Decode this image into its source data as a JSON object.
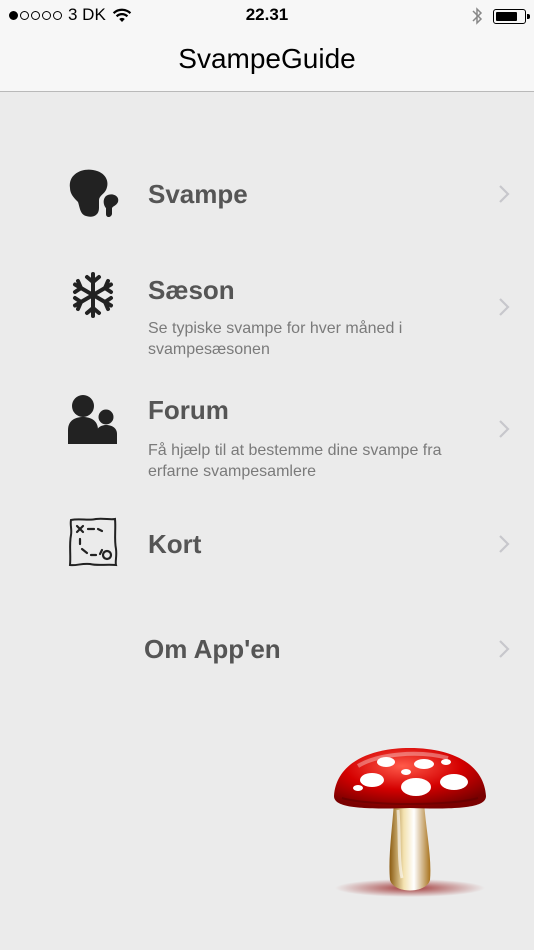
{
  "status": {
    "carrier": "3 DK",
    "time": "22.31",
    "signal_bars_filled": 1,
    "signal_bars_total": 5,
    "battery_level": 0.8
  },
  "nav": {
    "title": "SvampeGuide"
  },
  "menu": {
    "items": [
      {
        "title": "Svampe",
        "subtitle": "",
        "icon": "mushroom-icon"
      },
      {
        "title": "Sæson",
        "subtitle": "Se typiske svampe for hver måned i svampesæsonen",
        "icon": "snowflake-icon"
      },
      {
        "title": "Forum",
        "subtitle": "Få hjælp til at bestemme dine svampe fra erfarne svampesamlere",
        "icon": "people-icon"
      },
      {
        "title": "Kort",
        "subtitle": "",
        "icon": "treasure-map-icon"
      },
      {
        "title": "Om App'en",
        "subtitle": ""
      }
    ]
  },
  "colors": {
    "background": "#ebebeb",
    "bar": "#f7f7f7",
    "title_text": "#555555",
    "subtitle_text": "#7a7a7a",
    "chevron": "#c7c7cc",
    "mushroom_cap": "#d40000"
  }
}
